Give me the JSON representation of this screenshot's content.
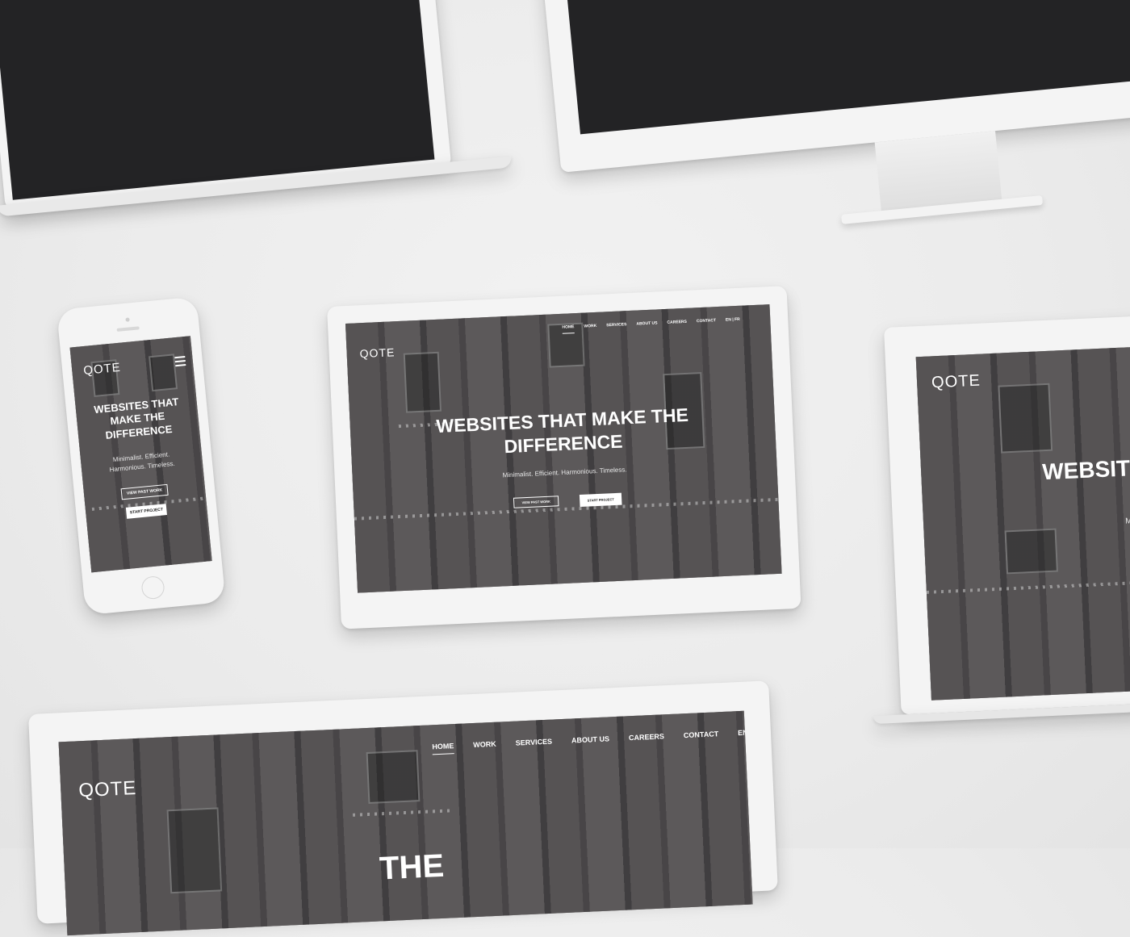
{
  "brand": "QOTE",
  "nav": [
    "HOME",
    "WORK",
    "SERVICES",
    "ABOUT US",
    "CAREERS",
    "CONTACT"
  ],
  "lang": "EN | FR",
  "hero": {
    "title_line": "WEBSITES THAT MAKE THE DIFFERENCE",
    "title_tablet_1": "WEBSITES THAT MAKE THE",
    "title_tablet_2": "DIFFERENCE",
    "title_phone_1": "WEBSITES THAT",
    "title_phone_2": "MAKE THE",
    "title_phone_3": "DIFFERENCE",
    "title_partial_right": "WEBSIT",
    "title_partial_bottom": "THE",
    "subtitle": "Minimalist. Efficient. Harmonious. Timeless.",
    "subtitle_phone_1": "Minimalist. Efficient.",
    "subtitle_phone_2": "Harmonious. Timeless.",
    "subtitle_partial_right": "Mi",
    "btn_view": "VIEW PAST WORK",
    "btn_start": "START PROJECT"
  },
  "colors": {
    "background": "#ebebeb",
    "device": "#f4f4f4",
    "dark_screen": "#232325",
    "text": "#ffffff"
  },
  "icons": [
    "hamburger-menu-icon"
  ]
}
